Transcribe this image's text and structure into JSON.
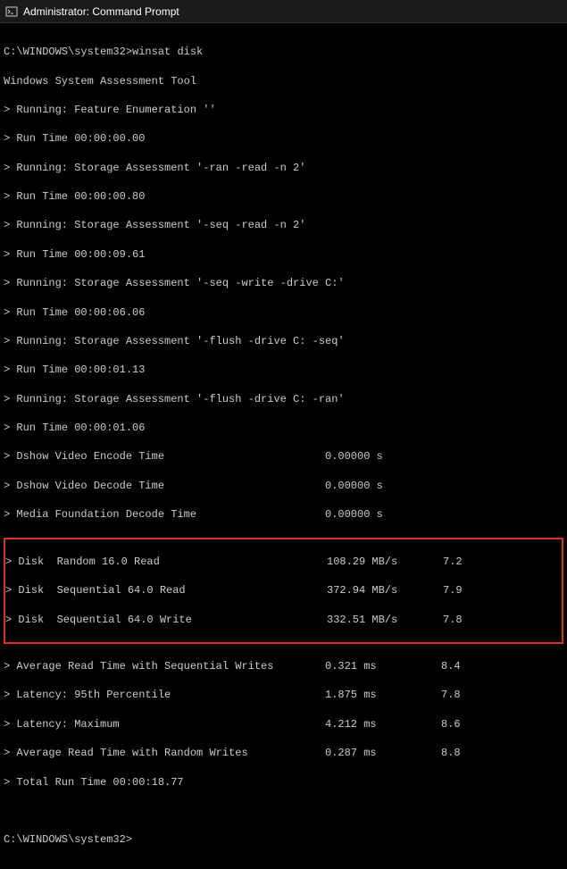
{
  "window": {
    "title": "Administrator: Command Prompt"
  },
  "prompt1": "C:\\WINDOWS\\system32>",
  "command": "winsat disk",
  "header": "Windows System Assessment Tool",
  "lines": {
    "l1": "> Running: Feature Enumeration ''",
    "l2": "> Run Time 00:00:00.00",
    "l3": "> Running: Storage Assessment '-ran -read -n 2'",
    "l4": "> Run Time 00:00:00.80",
    "l5": "> Running: Storage Assessment '-seq -read -n 2'",
    "l6": "> Run Time 00:00:09.61",
    "l7": "> Running: Storage Assessment '-seq -write -drive C:'",
    "l8": "> Run Time 00:00:06.06",
    "l9": "> Running: Storage Assessment '-flush -drive C: -seq'",
    "l10": "> Run Time 00:00:01.13",
    "l11": "> Running: Storage Assessment '-flush -drive C: -ran'",
    "l12": "> Run Time 00:00:01.06"
  },
  "metrics": {
    "m1": {
      "label": "> Dshow Video Encode Time",
      "v1": "0.00000 s",
      "v2": ""
    },
    "m2": {
      "label": "> Dshow Video Decode Time",
      "v1": "0.00000 s",
      "v2": ""
    },
    "m3": {
      "label": "> Media Foundation Decode Time",
      "v1": "0.00000 s",
      "v2": ""
    },
    "m4": {
      "label": "> Disk  Random 16.0 Read",
      "v1": "108.29 MB/s",
      "v2": "7.2"
    },
    "m5": {
      "label": "> Disk  Sequential 64.0 Read",
      "v1": "372.94 MB/s",
      "v2": "7.9"
    },
    "m6": {
      "label": "> Disk  Sequential 64.0 Write",
      "v1": "332.51 MB/s",
      "v2": "7.8"
    },
    "m7": {
      "label": "> Average Read Time with Sequential Writes",
      "v1": "0.321 ms",
      "v2": "8.4"
    },
    "m8": {
      "label": "> Latency: 95th Percentile",
      "v1": "1.875 ms",
      "v2": "7.8"
    },
    "m9": {
      "label": "> Latency: Maximum",
      "v1": "4.212 ms",
      "v2": "8.6"
    },
    "m10": {
      "label": "> Average Read Time with Random Writes",
      "v1": "0.287 ms",
      "v2": "8.8"
    }
  },
  "total": "> Total Run Time 00:00:18.77",
  "prompt2": "C:\\WINDOWS\\system32>"
}
